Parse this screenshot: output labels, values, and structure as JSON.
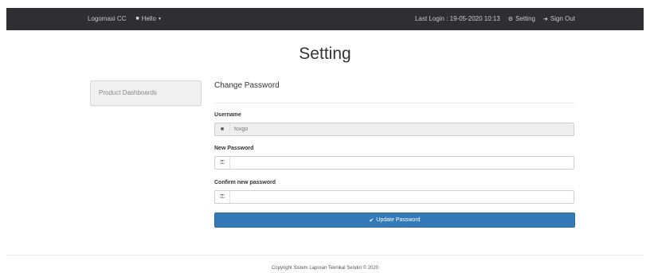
{
  "navbar": {
    "brand": "Logomaxi CC",
    "user_menu_label": "Hello",
    "last_login": "Last Login : 19-05-2020 10:13",
    "setting_label": "Setting",
    "signout_label": "Sign Out"
  },
  "page": {
    "title": "Setting"
  },
  "sidebar": {
    "items": [
      {
        "label": "Product Dashboards"
      }
    ]
  },
  "form": {
    "title": "Change Password",
    "username_label": "Username",
    "username_value": "foxgo",
    "new_password_label": "New Password",
    "new_password_value": "",
    "confirm_password_label": "Confirm new password",
    "confirm_password_value": "",
    "submit_label": "Update Password"
  },
  "footer": {
    "text": "Copyright Sistem Laporan Teknikal Sendiri © 2020"
  },
  "colors": {
    "navbar_bg": "#2f2f33",
    "primary_button": "#337ab7",
    "readonly_bg": "#eeeeee"
  },
  "icons": {
    "user": "user-icon",
    "key": "key-icon",
    "check": "check-icon",
    "gear": "gear-icon",
    "signout": "signout-icon",
    "caret": "chevron-down-icon"
  }
}
